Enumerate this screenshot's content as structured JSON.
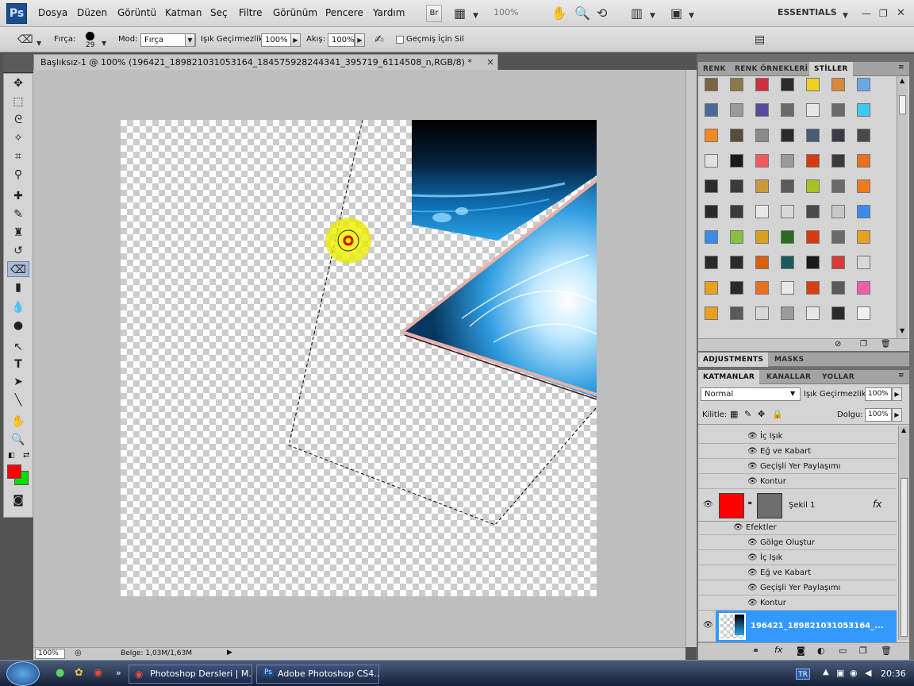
{
  "app": {
    "logo": "Ps",
    "workspace": "ESSENTIALS",
    "zoom_menu": "100%"
  },
  "menu": {
    "items": [
      "Dosya",
      "Düzen",
      "Görüntü",
      "Katman",
      "Seç",
      "Filtre",
      "Görünüm",
      "Pencere",
      "Yardım"
    ],
    "br_label": "Br"
  },
  "options": {
    "brush_label": "Fırça:",
    "brush_size": "29",
    "mode_label": "Mod:",
    "mode_value": "Fırça",
    "opacity_label": "Işık Geçirmezlik:",
    "opacity_value": "100%",
    "flow_label": "Akış:",
    "flow_value": "100%",
    "history_label": "Geçmiş İçin Sil"
  },
  "document": {
    "tab_title": "Başlıksız-1 @ 100% (196421_189821031053164_184575928244341_395719_6114508_n,RGB/8) *",
    "close": "×"
  },
  "status": {
    "zoom": "100%",
    "doc_info": "Belge: 1,03M/1,63M"
  },
  "styles_panel": {
    "tabs": [
      "RENK",
      "RENK ÖRNEKLERİ",
      "STİLLER"
    ],
    "active_tab": "STİLLER"
  },
  "adjust_panel": {
    "tabs": [
      "ADJUSTMENTS",
      "MASKS"
    ]
  },
  "layers_panel": {
    "tabs": [
      "KATMANLAR",
      "KANALLAR",
      "YOLLAR"
    ],
    "blend_mode": "Normal",
    "opacity_label": "Işık Geçirmezlik:",
    "opacity_value": "100%",
    "lock_label": "Kilitle:",
    "fill_label": "Dolgu:",
    "fill_value": "100%",
    "effects_top": [
      "İç Işık",
      "Eğ ve Kabart",
      "Geçişli Yer Paylaşımı",
      "Kontur"
    ],
    "shape_layer_name": "Şekil 1",
    "effects_header": "Efektler",
    "effects": [
      "Gölge Oluştur",
      "İç Işık",
      "Eğ ve Kabart",
      "Geçişli Yer Paylaşımı",
      "Kontur"
    ],
    "image_layer_name": "196421_189821031053164_..."
  },
  "taskbar": {
    "tasks": [
      "Photoshop Dersleri | M...",
      "Adobe Photoshop CS4..."
    ],
    "language": "TR",
    "clock": "20:36"
  },
  "colors": {
    "foreground": "#ff0000",
    "background": "#00e000",
    "selection_blue": "#3399ff"
  }
}
